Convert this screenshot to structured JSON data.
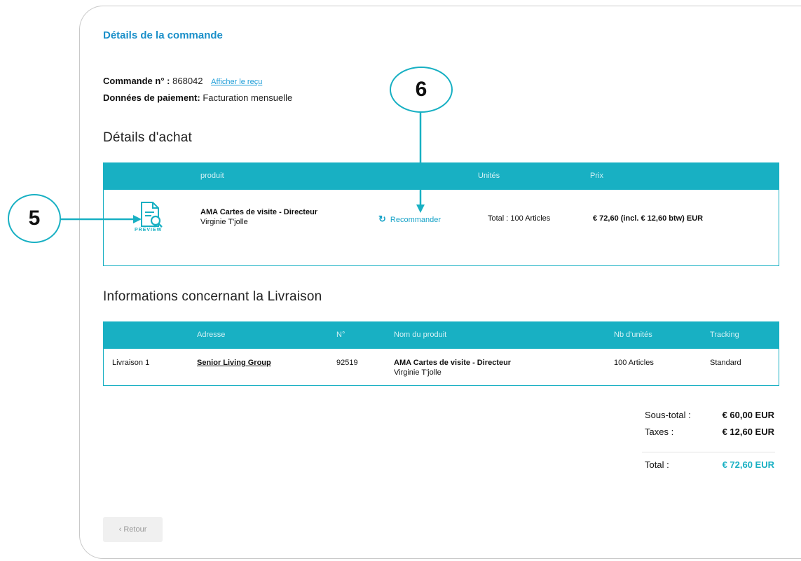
{
  "header": {
    "title": "Détails de la commande"
  },
  "order": {
    "number_label": "Commande n°",
    "number_sep": " :",
    "number_value": "868042",
    "receipt_link": "Afficher le reçu",
    "payment_label": "Données de paiement:",
    "payment_value": "Facturation mensuelle"
  },
  "purchase": {
    "section_title": "Détails d'achat",
    "columns": [
      "produit",
      "Unités",
      "Prix"
    ],
    "row": {
      "preview_label": "PREVIEW",
      "product_name": "AMA Cartes de visite - Directeur",
      "product_person": "Virginie T'jolle",
      "reorder_label": "Recommander",
      "units": "Total : 100 Articles",
      "price": "€ 72,60 (incl. € 12,60 btw) EUR"
    }
  },
  "delivery": {
    "section_title": "Informations concernant la Livraison",
    "columns": [
      "Adresse",
      "N°",
      "Nom du produit",
      "Nb d'unités",
      "Tracking"
    ],
    "row": {
      "label": "Livraison 1",
      "address": "Senior Living Group",
      "number": "92519",
      "product_name": "AMA Cartes de visite - Directeur",
      "product_person": "Virginie T'jolle",
      "units": "100 Articles",
      "tracking": "Standard"
    }
  },
  "totals": {
    "subtotal_label": "Sous-total :",
    "subtotal_value": "€ 60,00 EUR",
    "taxes_label": "Taxes :",
    "taxes_value": "€ 12,60 EUR",
    "total_label": "Total :",
    "total_value": "€ 72,60 EUR"
  },
  "back_button": "‹ Retour",
  "callouts": {
    "five": "5",
    "six": "6"
  },
  "colors": {
    "accent": "#18b0c3",
    "title": "#1a8fc9",
    "link": "#1a9bd7"
  },
  "icons": {
    "preview": "document-search-icon",
    "reorder": "refresh-icon"
  }
}
